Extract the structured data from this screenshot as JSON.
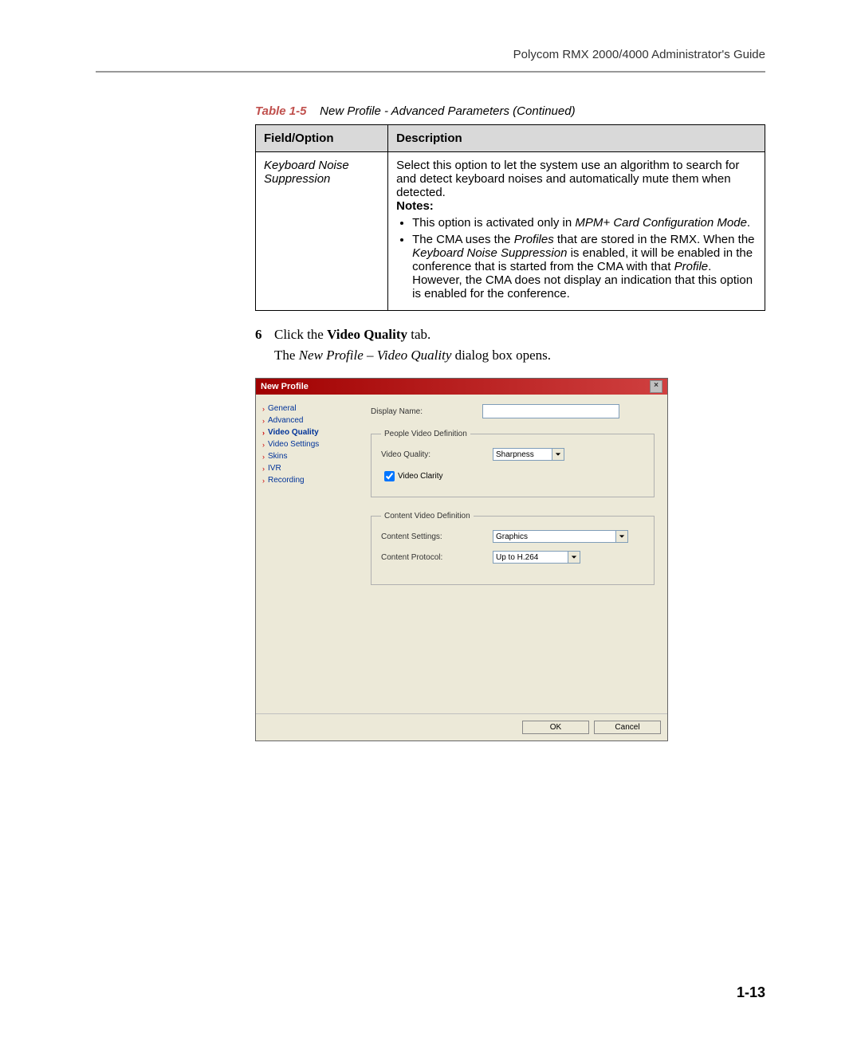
{
  "header": "Polycom RMX 2000/4000 Administrator's Guide",
  "table_caption_label": "Table 1-5",
  "table_caption_title": "New Profile - Advanced Parameters (Continued)",
  "table": {
    "col1": "Field/Option",
    "col2": "Description",
    "row": {
      "field": "Keyboard Noise Suppression",
      "desc_intro": "Select this option to let the system use an algorithm to search for and detect keyboard noises and automatically mute them when detected.",
      "notes_label": "Notes:",
      "note1_pre": "This option is activated only in ",
      "note1_em": "MPM+ Card Configuration Mode",
      "note1_post": ".",
      "note2_a": "The CMA uses the ",
      "note2_em1": "Profiles",
      "note2_b": " that are stored in the RMX. When the ",
      "note2_em2": "Keyboard Noise Suppression",
      "note2_c": " is enabled, it will be enabled in the conference that is started from the CMA with that ",
      "note2_em3": "Profile",
      "note2_d": ". However, the CMA does not display an indication that this option is enabled for the conference."
    }
  },
  "step_num": "6",
  "step_pre": "Click the ",
  "step_bold": "Video Quality",
  "step_post": " tab.",
  "dialog_sentence_pre": "The ",
  "dialog_sentence_em": "New Profile – Video Quality",
  "dialog_sentence_post": " dialog box opens.",
  "dialog": {
    "title": "New Profile",
    "nav": {
      "general": "General",
      "advanced": "Advanced",
      "video_quality": "Video Quality",
      "video_settings": "Video Settings",
      "skins": "Skins",
      "ivr": "IVR",
      "recording": "Recording"
    },
    "display_name_label": "Display Name:",
    "fs_people": "People Video Definition",
    "video_quality_label": "Video Quality:",
    "video_quality_value": "Sharpness",
    "video_clarity_label": "Video Clarity",
    "fs_content": "Content Video Definition",
    "content_settings_label": "Content Settings:",
    "content_settings_value": "Graphics",
    "content_protocol_label": "Content Protocol:",
    "content_protocol_value": "Up to H.264",
    "ok": "OK",
    "cancel": "Cancel",
    "close_x": "×"
  },
  "page_num": "1-13"
}
